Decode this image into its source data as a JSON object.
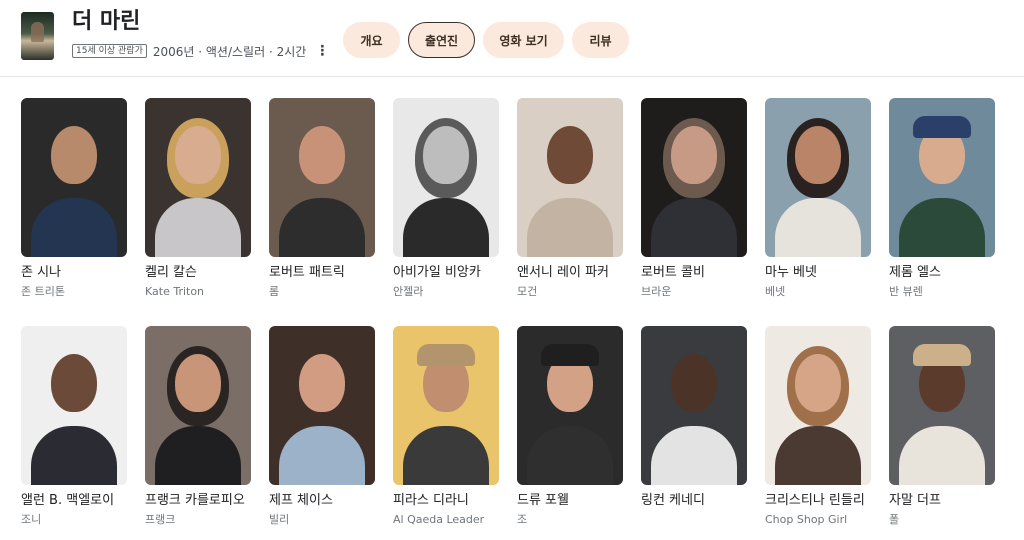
{
  "header": {
    "title": "더 마린",
    "rating": "15세 이상 관람가",
    "info": "2006년 · 액션/스릴러 · 2시간",
    "more_icon": "⋮",
    "poster_icon": "movie-poster-thumbnail"
  },
  "tabs": [
    {
      "label": "개요",
      "active": false
    },
    {
      "label": "출연진",
      "active": true
    },
    {
      "label": "영화 보기",
      "active": false
    },
    {
      "label": "리뷰",
      "active": false
    }
  ],
  "colors": {
    "tab_bg": "#fbe9dd",
    "tab_text": "#3c2f25",
    "text_primary": "#202124",
    "text_secondary": "#70757a"
  },
  "cast": [
    {
      "name": "존 시나",
      "role": "존 트리톤",
      "bg": "#2a2a2a",
      "skin": "#b78a6c",
      "shirt": "#243552"
    },
    {
      "name": "켈리 칼슨",
      "role": "Kate Triton",
      "bg": "#3a3330",
      "skin": "#d8ad8f",
      "shirt": "#c9c6c9",
      "hair": "#c9a15c"
    },
    {
      "name": "로버트 패트릭",
      "role": "롬",
      "bg": "#6b5b4f",
      "skin": "#c89278",
      "shirt": "#2d2d2d"
    },
    {
      "name": "아비가일 비앙카",
      "role": "안젤라",
      "bg": "#e8e8e8",
      "skin": "#bdbdbd",
      "shirt": "#2a2a2a",
      "hair": "#5a5a5a"
    },
    {
      "name": "앤서니 레이 파커",
      "role": "모건",
      "bg": "#d9cfc4",
      "skin": "#6e4a37",
      "shirt": "#c2b3a3"
    },
    {
      "name": "로버트 콜비",
      "role": "브라운",
      "bg": "#1f1d1c",
      "skin": "#c79a85",
      "shirt": "#2e3036",
      "hair": "#6b5a4d"
    },
    {
      "name": "마누 베넷",
      "role": "베넷",
      "bg": "#8aa1ad",
      "skin": "#b98467",
      "shirt": "#e6e2dc",
      "hair": "#2a2220"
    },
    {
      "name": "제롬 엘스",
      "role": "반 뷰렌",
      "bg": "#6f8a9a",
      "skin": "#d9ab8e",
      "shirt": "#2b4a3a",
      "hat": "#2b3f6b"
    },
    {
      "name": "앨런 B. 맥엘로이",
      "role": "조니",
      "bg": "#efefef",
      "skin": "#6b4a3a",
      "shirt": "#2b2b33"
    },
    {
      "name": "프랭크 카를로피오",
      "role": "프랭크",
      "bg": "#7b6e66",
      "skin": "#c99579",
      "shirt": "#1f1f22",
      "hair": "#2a2523"
    },
    {
      "name": "제프 체이스",
      "role": "빌리",
      "bg": "#3e2f28",
      "skin": "#d19c82",
      "shirt": "#9bb2c8"
    },
    {
      "name": "피라스 디라니",
      "role": "Al Qaeda Leader",
      "bg": "#e9c46a",
      "skin": "#c18f6f",
      "shirt": "#3a3a3a",
      "hat": "#b3956d"
    },
    {
      "name": "드류 포웰",
      "role": "조",
      "bg": "#2b2b2b",
      "skin": "#d3a186",
      "shirt": "#2f2f2f",
      "hat": "#1f1f1f"
    },
    {
      "name": "링컨 케네디",
      "role": "",
      "bg": "#3a3b3e",
      "skin": "#4c3328",
      "shirt": "#e3e3e3"
    },
    {
      "name": "크리스티나 린들리",
      "role": "Chop Shop Girl",
      "bg": "#efe9e4",
      "skin": "#d6a588",
      "shirt": "#4a3a31",
      "hair": "#a0704a"
    },
    {
      "name": "자말 더프",
      "role": "폴",
      "bg": "#5d5f63",
      "skin": "#5b3b2c",
      "shirt": "#e8e3db",
      "hat": "#cbb08a"
    }
  ]
}
